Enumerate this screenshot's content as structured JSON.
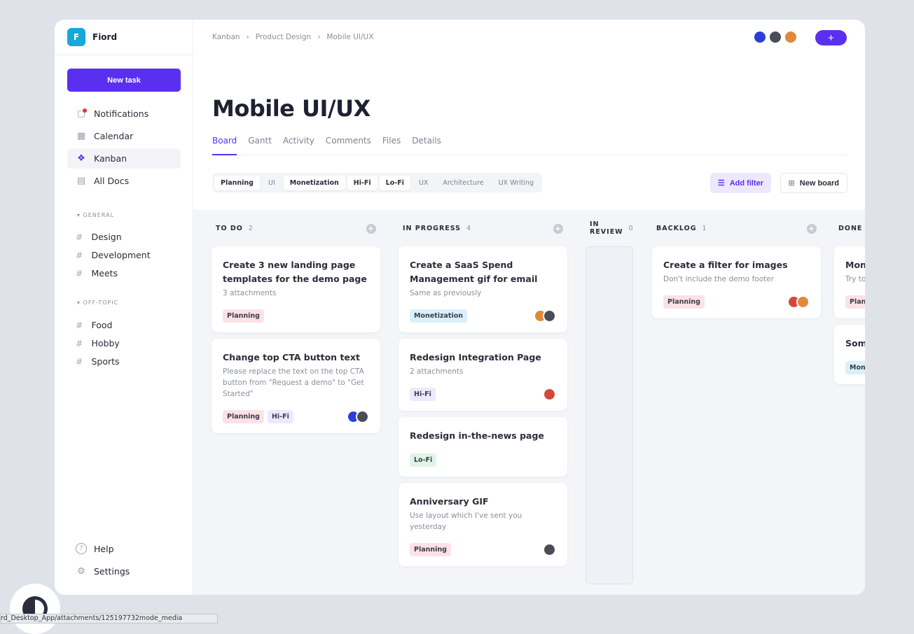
{
  "app": {
    "logo_letter": "F",
    "name": "Fiord"
  },
  "sidebar": {
    "new_task": "New task",
    "items": [
      {
        "label": "Notifications",
        "icon": "notification-icon"
      },
      {
        "label": "Calendar",
        "icon": "calendar-icon"
      },
      {
        "label": "Kanban",
        "icon": "kanban-icon",
        "active": true
      },
      {
        "label": "All Docs",
        "icon": "docs-icon"
      }
    ],
    "sections": [
      {
        "title": "GENERAL",
        "channels": [
          "Design",
          "Development",
          "Meets"
        ]
      },
      {
        "title": "OFF-TOPIC",
        "channels": [
          "Food",
          "Hobby",
          "Sports"
        ]
      }
    ],
    "help": "Help",
    "settings": "Settings"
  },
  "breadcrumb": [
    "Kanban",
    "Product Design",
    "Mobile UI/UX"
  ],
  "header": {
    "title": "Mobile UI/UX",
    "plus": "+"
  },
  "tabs": [
    "Board",
    "Gantt",
    "Activity",
    "Comments",
    "Files",
    "Details"
  ],
  "filters": [
    {
      "label": "Planning",
      "on": true
    },
    {
      "label": "UI",
      "on": false
    },
    {
      "label": "Monetization",
      "on": true
    },
    {
      "label": "Hi-Fi",
      "on": true
    },
    {
      "label": "Lo-Fi",
      "on": true
    },
    {
      "label": "UX",
      "on": false
    },
    {
      "label": "Architecture",
      "on": false
    },
    {
      "label": "UX Writing",
      "on": false
    }
  ],
  "actions": {
    "add_filter": "Add filter",
    "new_board": "New board"
  },
  "colors": {
    "accent": "#5b2ff0",
    "Planning": "#fde1e7",
    "Monetization": "#d9f0fb",
    "Hi-Fi": "#ece8fd",
    "Lo-Fi": "#dff5e5",
    "blue": "#2b3fd6",
    "dark": "#4a4d55",
    "orange": "#e0893b",
    "red": "#d4483a"
  },
  "header_avatars": [
    "blue",
    "dark",
    "orange"
  ],
  "columns": [
    {
      "title": "TO DO",
      "count": "2",
      "cards": [
        {
          "title": "Create 3 new landing page templates for the demo page",
          "desc": "3 attachments",
          "tags": [
            "Planning"
          ],
          "avatars": []
        },
        {
          "title": "Change top CTA button text",
          "desc": "Please replace the text on the top CTA button from \"Request a demo\" to \"Get Started\"",
          "tags": [
            "Planning",
            "Hi-Fi"
          ],
          "avatars": [
            "blue",
            "dark"
          ]
        }
      ]
    },
    {
      "title": "IN PROGRESS",
      "count": "4",
      "cards": [
        {
          "title": "Create a SaaS Spend Management gif for email",
          "desc": "Same as previously",
          "tags": [
            "Monetization"
          ],
          "avatars": [
            "orange",
            "dark"
          ]
        },
        {
          "title": "Redesign Integration Page",
          "desc": "2 attachments",
          "tags": [
            "Hi-Fi"
          ],
          "avatars": [
            "red"
          ]
        },
        {
          "title": "Redesign in-the-news page",
          "desc": "",
          "tags": [
            "Lo-Fi"
          ],
          "avatars": []
        },
        {
          "title": "Anniversary GIF",
          "desc": "Use layout which I've sent you yesterday",
          "tags": [
            "Planning"
          ],
          "avatars": [
            "dark"
          ]
        }
      ]
    },
    {
      "title": "IN REVIEW",
      "count": "0",
      "cards": []
    },
    {
      "title": "BACKLOG",
      "count": "1",
      "cards": [
        {
          "title": "Create a filter for images",
          "desc": "Don't include the demo footer",
          "tags": [
            "Planning"
          ],
          "avatars": [
            "red",
            "orange"
          ]
        }
      ]
    },
    {
      "title": "DONE",
      "count": "",
      "cards": [
        {
          "title": "Mon",
          "desc": "Try to befor",
          "tags": [
            "Planning"
          ],
          "avatars": []
        },
        {
          "title": "Som",
          "desc": "",
          "tags": [
            "Monetization"
          ],
          "avatars": []
        }
      ]
    }
  ],
  "status_bar": "rd_Desktop_App/attachments/125197732mode_media"
}
